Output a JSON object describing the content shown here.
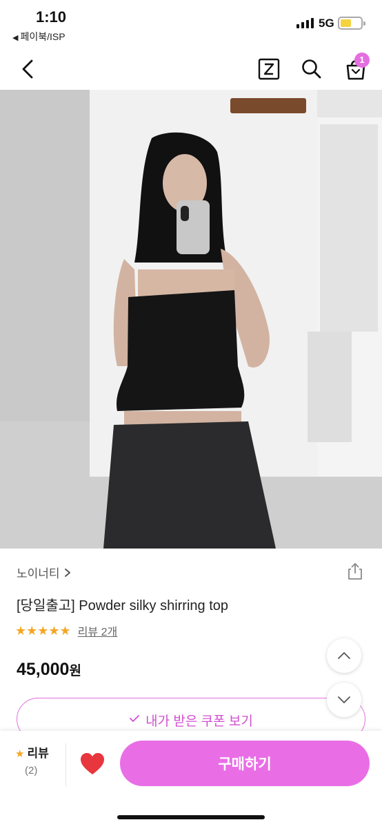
{
  "status_bar": {
    "time": "1:10",
    "back_app": "페이북/ISP",
    "network": "5G"
  },
  "nav": {
    "cart_count": "1",
    "z_icon_letter": "Z"
  },
  "product": {
    "brand": "노이너티",
    "name": "[당일출고] Powder silky shirring top",
    "stars": "★★★★★",
    "review_link": "리뷰 2개",
    "price": "45,000",
    "currency": "원"
  },
  "coupon": {
    "label": "내가 받은 쿠폰 보기"
  },
  "bottom_bar": {
    "review_label": "리뷰",
    "review_count": "(2)",
    "buy_label": "구매하기"
  },
  "colors": {
    "accent": "#e96ee6",
    "star": "#f5a623",
    "heart": "#e8363f"
  }
}
